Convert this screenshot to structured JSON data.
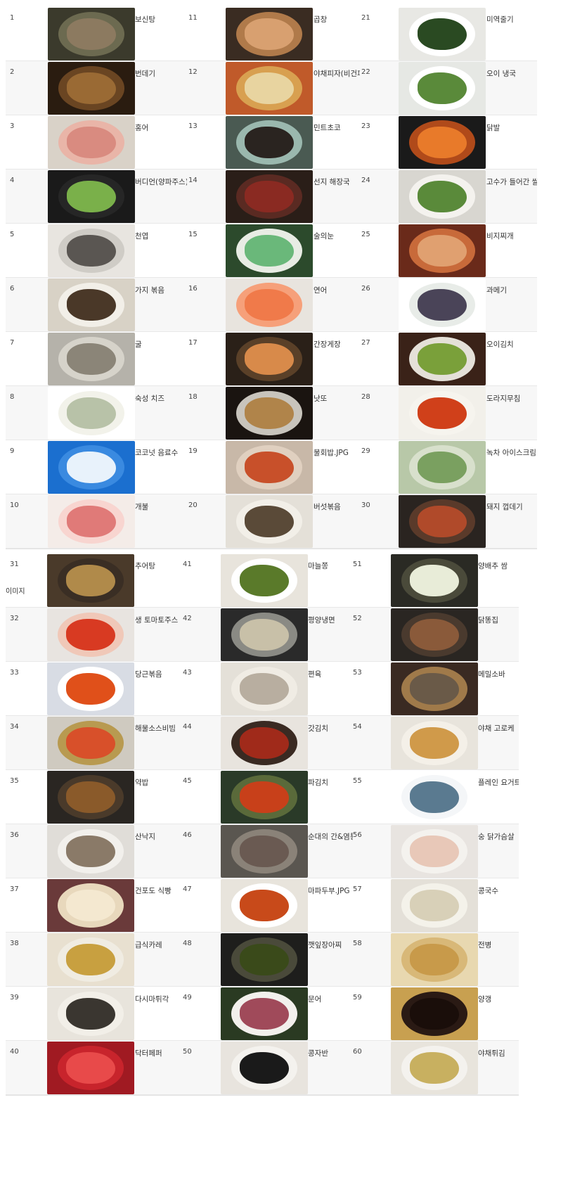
{
  "blocks": [
    {
      "columns": [
        {
          "items": [
            {
              "num": "1",
              "name": "보신탕",
              "bg": "#3b3a2c",
              "plate": "#6c6a50",
              "food": "#8c7a60"
            },
            {
              "num": "2",
              "name": "번데기",
              "bg": "#2a1c10",
              "plate": "#6a4522",
              "food": "#9a6a34"
            },
            {
              "num": "3",
              "name": "홍어",
              "bg": "#d9d2c8",
              "plate": "#e9b5a8",
              "food": "#d98b80"
            },
            {
              "num": "4",
              "name": "버디언(양파주스)",
              "bg": "#1a1a1a",
              "plate": "#262626",
              "food": "#7ab04a"
            },
            {
              "num": "5",
              "name": "천엽",
              "bg": "#e8e5e0",
              "plate": "#cfccc6",
              "food": "#5a5652"
            },
            {
              "num": "6",
              "name": "가지 볶음",
              "bg": "#d8d2c6",
              "plate": "#f2efe8",
              "food": "#4a3828"
            },
            {
              "num": "7",
              "name": "굴",
              "bg": "#b5b2aa",
              "plate": "#d6d3ca",
              "food": "#8b8578"
            },
            {
              "num": "8",
              "name": "숙성 치즈",
              "bg": "#ffffff",
              "plate": "#f2f2ea",
              "food": "#b8c2a8"
            },
            {
              "num": "9",
              "name": "코코넛 음료수",
              "bg": "#1b6fcf",
              "plate": "#3a8ae0",
              "food": "#e8f2fb"
            },
            {
              "num": "10",
              "name": "개불",
              "bg": "#f4ece8",
              "plate": "#f8d5d0",
              "food": "#e07a78"
            }
          ]
        },
        {
          "items": [
            {
              "num": "11",
              "name": "곱창",
              "bg": "#3a2c22",
              "plate": "#b07a4a",
              "food": "#d8a070"
            },
            {
              "num": "12",
              "name": "야채피자(비건피자)",
              "bg": "#c05a2a",
              "plate": "#d8a050",
              "food": "#e8d4a0"
            },
            {
              "num": "13",
              "name": "민트초코",
              "bg": "#4a5a52",
              "plate": "#9ab8ae",
              "food": "#2a2420"
            },
            {
              "num": "14",
              "name": "선지 해장국",
              "bg": "#2a1e18",
              "plate": "#5a2a22",
              "food": "#8a2a22"
            },
            {
              "num": "15",
              "name": "술의눈",
              "bg": "#2c4a2c",
              "plate": "#e8ece4",
              "food": "#6ab87a"
            },
            {
              "num": "16",
              "name": "연어",
              "bg": "#e8e4de",
              "plate": "#f6a07a",
              "food": "#f07a4a"
            },
            {
              "num": "17",
              "name": "간장게장",
              "bg": "#2a2018",
              "plate": "#5a4028",
              "food": "#d88a4a"
            },
            {
              "num": "18",
              "name": "낫또",
              "bg": "#1a1410",
              "plate": "#c8c4bc",
              "food": "#b0844a"
            },
            {
              "num": "19",
              "name": "물회밥.JPG",
              "bg": "#c8b8a8",
              "plate": "#e0d0c0",
              "food": "#c8502a"
            },
            {
              "num": "20",
              "name": "버섯볶음",
              "bg": "#e4e0d8",
              "plate": "#f2efe8",
              "food": "#5a4a38"
            }
          ]
        },
        {
          "items": [
            {
              "num": "21",
              "name": "미역줄기",
              "bg": "#e8e8e4",
              "plate": "#ffffff",
              "food": "#2a4a22"
            },
            {
              "num": "22",
              "name": "오이 냉국",
              "bg": "#e6e8e4",
              "plate": "#ffffff",
              "food": "#5a8a3a"
            },
            {
              "num": "23",
              "name": "닭발",
              "bg": "#1a1a1a",
              "plate": "#b04a1a",
              "food": "#e87a2a"
            },
            {
              "num": "24",
              "name": "고수가 들어간 쌀국수",
              "bg": "#d8d6d0",
              "plate": "#f4f2ee",
              "food": "#5a8a3a"
            },
            {
              "num": "25",
              "name": "비지찌개",
              "bg": "#6a2a1a",
              "plate": "#c86a3a",
              "food": "#e0a070"
            },
            {
              "num": "26",
              "name": "과메기",
              "bg": "#ffffff",
              "plate": "#e8ece8",
              "food": "#4a4458"
            },
            {
              "num": "27",
              "name": "오이김치",
              "bg": "#3a2218",
              "plate": "#e4e0d8",
              "food": "#7aa03a"
            },
            {
              "num": "28",
              "name": "도라지무침",
              "bg": "#f2f0ea",
              "plate": "#f6f4ee",
              "food": "#d0401a"
            },
            {
              "num": "29",
              "name": "녹차 아이스크림",
              "bg": "#b8c8a8",
              "plate": "#d8e0cc",
              "food": "#7aa060"
            },
            {
              "num": "30",
              "name": "돼지 껍데기",
              "bg": "#2a2420",
              "plate": "#5a3a2a",
              "food": "#b04a2a"
            }
          ]
        }
      ]
    },
    {
      "columns": [
        {
          "items": [
            {
              "num": "31",
              "name": "추어탕",
              "bg": "#4a3a2a",
              "plate": "#3a2e24",
              "food": "#b08a4a"
            },
            {
              "num": "32",
              "name": "생 토마토주스",
              "bg": "#e8e4e0",
              "plate": "#f0c8b8",
              "food": "#d83a22"
            },
            {
              "num": "33",
              "name": "당근볶음",
              "bg": "#d8dce4",
              "plate": "#ffffff",
              "food": "#e0501a"
            },
            {
              "num": "34",
              "name": "해물소스비빔",
              "bg": "#cfcac0",
              "plate": "#b89a50",
              "food": "#d8502a"
            },
            {
              "num": "35",
              "name": "약밥",
              "bg": "#2a2622",
              "plate": "#4a3a2a",
              "food": "#8a5a2a"
            },
            {
              "num": "36",
              "name": "산낙지",
              "bg": "#e0ddd8",
              "plate": "#f2f0ec",
              "food": "#8a7a68"
            },
            {
              "num": "37",
              "name": "건포도 식빵",
              "bg": "#6a3a3a",
              "plate": "#e8d8bc",
              "food": "#f4e8d0"
            },
            {
              "num": "38",
              "name": "급식카레",
              "bg": "#e8e0d0",
              "plate": "#f0ece2",
              "food": "#c8a040"
            },
            {
              "num": "39",
              "name": "다시마튀각",
              "bg": "#e8e4dc",
              "plate": "#f2efe8",
              "food": "#3a3630"
            },
            {
              "num": "40",
              "name": "닥터페퍼",
              "bg": "#a01a22",
              "plate": "#c8242c",
              "food": "#e84a4a"
            }
          ]
        },
        {
          "items": [
            {
              "num": "41",
              "name": "마늘쫑",
              "bg": "#e8e4dc",
              "plate": "#ffffff",
              "food": "#5a7a2a"
            },
            {
              "num": "42",
              "name": "평양냉면",
              "bg": "#2a2a2a",
              "plate": "#8a8a84",
              "food": "#c8c0a8"
            },
            {
              "num": "43",
              "name": "편육",
              "bg": "#e4e0d8",
              "plate": "#f0ece4",
              "food": "#b8aea0"
            },
            {
              "num": "44",
              "name": "갓김치",
              "bg": "#e8e4de",
              "plate": "#3a2a22",
              "food": "#a02a1a"
            },
            {
              "num": "45",
              "name": "파김치",
              "bg": "#2a3a28",
              "plate": "#5a6a3a",
              "food": "#c8401a"
            },
            {
              "num": "46",
              "name": "순대의 간&염통",
              "bg": "#5a5650",
              "plate": "#8a8278",
              "food": "#6a5a52"
            },
            {
              "num": "47",
              "name": "마파두부.JPG",
              "bg": "#e8e4dc",
              "plate": "#ffffff",
              "food": "#c84a1a"
            },
            {
              "num": "48",
              "name": "깻잎장아찌",
              "bg": "#1e1e1c",
              "plate": "#4a4a3a",
              "food": "#3a4a1a"
            },
            {
              "num": "49",
              "name": "문어",
              "bg": "#2a3a22",
              "plate": "#f2f0ec",
              "food": "#a04a5a"
            },
            {
              "num": "50",
              "name": "콩자반",
              "bg": "#e8e4de",
              "plate": "#f4f2ee",
              "food": "#1a1a1a"
            }
          ]
        },
        {
          "items": [
            {
              "num": "51",
              "name": "양배추 쌈",
              "bg": "#2a2a24",
              "plate": "#4a4a3a",
              "food": "#e8ecd8"
            },
            {
              "num": "52",
              "name": "닭똥집",
              "bg": "#2a2622",
              "plate": "#4a3a2e",
              "food": "#8a5a3a"
            },
            {
              "num": "53",
              "name": "메밀소바",
              "bg": "#3a2a22",
              "plate": "#a07a4a",
              "food": "#6a5a48"
            },
            {
              "num": "54",
              "name": "야채 고로케",
              "bg": "#e8e4dc",
              "plate": "#f4f0e8",
              "food": "#d09a4a"
            },
            {
              "num": "55",
              "name": "플레인 요거트",
              "bg": "#ffffff",
              "plate": "#f4f6f8",
              "food": "#5a7a90"
            },
            {
              "num": "56",
              "name": "숭 닭가슴살",
              "bg": "#e8e4e0",
              "plate": "#f4f2ee",
              "food": "#e8c8b8"
            },
            {
              "num": "57",
              "name": "콩국수",
              "bg": "#e4e0d8",
              "plate": "#f4f2ea",
              "food": "#d8d0b8"
            },
            {
              "num": "58",
              "name": "전병",
              "bg": "#e8d8b0",
              "plate": "#d8b878",
              "food": "#c89a4a"
            },
            {
              "num": "59",
              "name": "양갱",
              "bg": "#c8a050",
              "plate": "#2a1a14",
              "food": "#1a0e0a"
            },
            {
              "num": "60",
              "name": "야채튀김",
              "bg": "#e8e4dc",
              "plate": "#f4f2ee",
              "food": "#c8b060"
            }
          ]
        }
      ]
    }
  ],
  "stray_text": "이미지"
}
